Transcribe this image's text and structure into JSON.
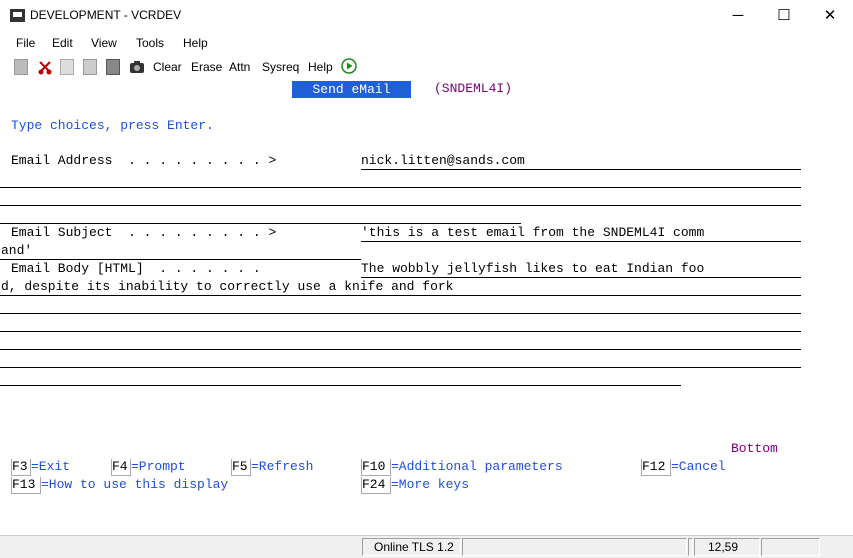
{
  "window": {
    "title": "DEVELOPMENT - VCRDEV",
    "minimize": "─",
    "maximize": "☐",
    "close": "✕"
  },
  "menu": [
    "File",
    "Edit",
    "View",
    "Tools",
    "Help"
  ],
  "toolbar": {
    "clear": "Clear",
    "erase": "Erase",
    "attn": "Attn",
    "sysreq": "Sysreq",
    "help": "Help"
  },
  "screen": {
    "title": "Send eMail",
    "program": "(SNDEML4I)",
    "instruction": "Type choices, press Enter.",
    "email_address_label": "Email Address  . . . . . . . . . >",
    "email_address_value": "nick.litten@sands.com",
    "email_subject_label": "Email Subject  . . . . . . . . . >",
    "email_subject_line1": "'this is a test email from the SNDEML4I comm",
    "email_subject_line2": "and'",
    "email_body_label": "Email Body [HTML]  . . . . . . .",
    "email_body_line1": "The wobbly jellyfish likes to eat Indian foo",
    "email_body_line2": "d, despite its inability to correctly use a knife and fork",
    "bottom": "Bottom"
  },
  "fkeys": {
    "f3": "F3",
    "f3_desc": "=Exit",
    "f4": "F4",
    "f4_desc": "=Prompt",
    "f5": "F5",
    "f5_desc": "=Refresh",
    "f10": "F10",
    "f10_desc": "=Additional parameters",
    "f12": "F12",
    "f12_desc": "=Cancel",
    "f13": "F13",
    "f13_desc": "=How to use this display",
    "f24": "F24",
    "f24_desc": "=More keys"
  },
  "status": {
    "connection": "Online TLS 1.2",
    "cursor": "12,59"
  }
}
